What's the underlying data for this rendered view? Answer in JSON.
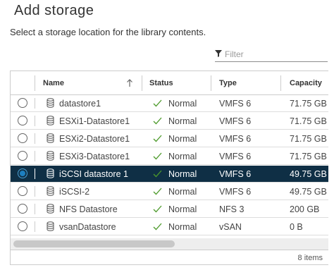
{
  "page": {
    "title": "Add storage",
    "subtitle": "Select a storage location for the library contents."
  },
  "filter": {
    "placeholder": "Filter"
  },
  "table": {
    "columns": {
      "name": "Name",
      "status": "Status",
      "type": "Type",
      "capacity": "Capacity"
    },
    "sort": {
      "column": "name",
      "direction": "ascending",
      "icon": "arrow-up-icon"
    },
    "rows": [
      {
        "name": "datastore1",
        "status": "Normal",
        "type": "VMFS 6",
        "capacity": "71.75 GB",
        "selected": false
      },
      {
        "name": "ESXi1-Datastore1",
        "status": "Normal",
        "type": "VMFS 6",
        "capacity": "71.75 GB",
        "selected": false
      },
      {
        "name": "ESXi2-Datastore1",
        "status": "Normal",
        "type": "VMFS 6",
        "capacity": "71.75 GB",
        "selected": false
      },
      {
        "name": "ESXi3-Datastore1",
        "status": "Normal",
        "type": "VMFS 6",
        "capacity": "71.75 GB",
        "selected": false
      },
      {
        "name": "iSCSI datastore 1",
        "status": "Normal",
        "type": "VMFS 6",
        "capacity": "49.75 GB",
        "selected": true
      },
      {
        "name": "iSCSI-2",
        "status": "Normal",
        "type": "VMFS 6",
        "capacity": "49.75 GB",
        "selected": false
      },
      {
        "name": "NFS Datastore",
        "status": "Normal",
        "type": "NFS 3",
        "capacity": "200 GB",
        "selected": false
      },
      {
        "name": "vsanDatastore",
        "status": "Normal",
        "type": "vSAN",
        "capacity": "0 B",
        "selected": false
      }
    ],
    "footer": {
      "item_count": "8 items"
    }
  },
  "colors": {
    "selected_row_bg": "#0f2f45",
    "status_ok": "#4c9a2a",
    "radio_selected": "#1d7fc0"
  },
  "icons": {
    "filter": "filter-icon",
    "datastore": "datastore-icon",
    "status_ok": "check-icon",
    "sort": "arrow-up-icon"
  }
}
